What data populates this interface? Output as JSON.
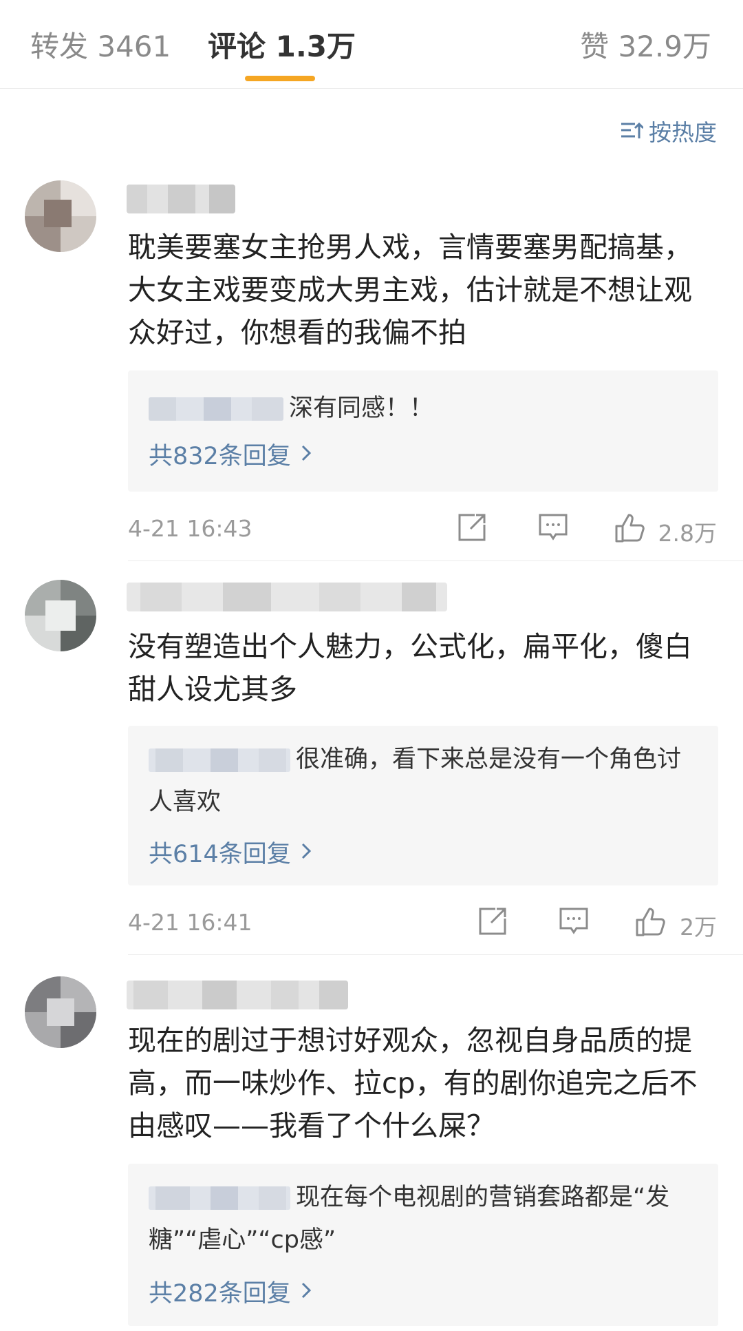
{
  "tabs": {
    "repost": "转发 3461",
    "comments": "评论 1.3万",
    "likes": "赞 32.9万"
  },
  "sort_label": "按热度",
  "comments": [
    {
      "text": "耽美要塞女主抢男人戏，言情要塞男配搞基，大女主戏要变成大男主戏，估计就是不想让观众好过，你想看的我偏不拍",
      "reply_text": "深有同感！！",
      "reply_count": "共832条回复",
      "time": "4-21 16:43",
      "likes": "2.8万"
    },
    {
      "text": "没有塑造出个人魅力，公式化，扁平化，傻白甜人设尤其多",
      "reply_text": "很准确，看下来总是没有一个角色讨人喜欢",
      "reply_count": "共614条回复",
      "time": "4-21 16:41",
      "likes": "2万"
    },
    {
      "text": "现在的剧过于想讨好观众，忽视自身品质的提高，而一味炒作、拉cp，有的剧你追完之后不由感叹——我看了个什么屎？",
      "reply_text": "现在每个电视剧的营销套路都是“发糖”“虐心”“cp感”",
      "reply_count": "共282条回复"
    }
  ],
  "colors": {
    "accent_underline": "#f5a623",
    "link_blue": "#5b7fa6",
    "muted_gray": "#9a9a9a"
  },
  "icons": [
    "sort-icon",
    "share-icon",
    "comment-icon",
    "like-icon",
    "chevron-right-icon"
  ]
}
